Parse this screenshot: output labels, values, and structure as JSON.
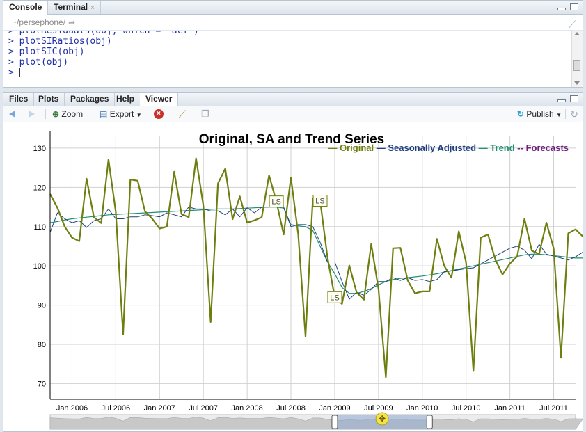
{
  "console_pane": {
    "tabs": [
      {
        "label": "Console"
      },
      {
        "label": "Terminal",
        "close": "×"
      }
    ],
    "path": "~/persephone/",
    "lines": [
      {
        "prompt": ">",
        "code": "plotResiduals(obj, which = \"acf\")"
      },
      {
        "prompt": ">",
        "code": "plotSIRatios(obj)"
      },
      {
        "prompt": ">",
        "code": "plotSIC(obj)"
      },
      {
        "prompt": ">",
        "code": "plot(obj)"
      },
      {
        "prompt": ">",
        "code": ""
      }
    ]
  },
  "viewer_pane": {
    "tabs": [
      {
        "label": "Files"
      },
      {
        "label": "Plots"
      },
      {
        "label": "Packages"
      },
      {
        "label": "Help"
      },
      {
        "label": "Viewer"
      }
    ],
    "active_tab": "Viewer",
    "toolbar": {
      "zoom": "Zoom",
      "export": "Export",
      "publish": "Publish"
    }
  },
  "icons": [
    "back-arrow-icon",
    "forward-arrow-icon",
    "zoom-icon",
    "export-icon",
    "clear-viewer-icon",
    "broom-icon",
    "popout-icon",
    "publish-icon",
    "refresh-icon",
    "minimize-icon",
    "maximize-icon",
    "pan-handle-icon"
  ],
  "colors": {
    "original": "#6f7f0f",
    "seasonally_adjusted": "#1f3f7f",
    "trend": "#1f8f6f",
    "forecasts": "#6f1f7f",
    "grid": "#d0d0d0"
  },
  "chart_data": {
    "type": "line",
    "title": "Original, SA and Trend Series",
    "ylim": [
      66,
      133
    ],
    "yticks": [
      70,
      80,
      90,
      100,
      110,
      120,
      130
    ],
    "x_start": "2005-10",
    "x_end": "2011-10",
    "xticks": [
      "Jan 2006",
      "Jul 2006",
      "Jan 2007",
      "Jul 2007",
      "Jan 2008",
      "Jul 2008",
      "Jan 2009",
      "Jul 2009",
      "Jan 2010",
      "Jul 2010",
      "Jan 2011",
      "Jul 2011"
    ],
    "grid": true,
    "legend_position": "top-right",
    "legend": [
      {
        "name": "Original",
        "color": "#6f7f0f"
      },
      {
        "name": "Seasonally Adjusted",
        "color": "#1f3f7f"
      },
      {
        "name": "Trend",
        "color": "#1f8f6f"
      },
      {
        "name": "Forecasts",
        "color": "#6f1f7f",
        "dashed": true
      }
    ],
    "annotations": [
      {
        "label": "LS",
        "date": "2008-05"
      },
      {
        "label": "LS",
        "date": "2008-11"
      },
      {
        "label": "LS",
        "date": "2009-01"
      }
    ],
    "series": [
      {
        "name": "Original",
        "start": "2005-10",
        "values": [
          118.3,
          114.8,
          110,
          107.2,
          106.3,
          122.2,
          112.4,
          110.9,
          127.1,
          113.7,
          82.5,
          122,
          121.7,
          113.9,
          112,
          109.5,
          110,
          124,
          113.2,
          112.4,
          127.4,
          115.4,
          85.7,
          121,
          124.8,
          111.9,
          117.7,
          111,
          111.6,
          112.4,
          123.1,
          116.4,
          108,
          122.5,
          108,
          82,
          117.2,
          116.6,
          102.2,
          92,
          90.3,
          100.1,
          93.2,
          91.4,
          105.6,
          94,
          71.6,
          104.5,
          104.6,
          96.3,
          93,
          93.5,
          93.5,
          106.9,
          100,
          97,
          108.8,
          100.9,
          73.2,
          107.2,
          108,
          101.6,
          97.8,
          100.6,
          102.4,
          112,
          103.9,
          103,
          111,
          104.5,
          76.6,
          108.3,
          109.3,
          107.5
        ]
      },
      {
        "name": "Seasonally Adjusted",
        "start": "2005-10",
        "values": [
          108.5,
          113.5,
          112,
          111,
          111.5,
          109.8,
          111.5,
          112,
          114.5,
          112,
          112,
          112.5,
          112.5,
          113,
          112.8,
          112.5,
          113.5,
          113,
          112.5,
          115,
          114.5,
          114.5,
          114,
          114,
          113,
          114.5,
          112.5,
          114.8,
          113.5,
          115,
          115,
          115.3,
          115,
          110,
          110.5,
          110.5,
          110,
          106,
          101,
          101,
          96,
          91.5,
          93.3,
          92.5,
          94,
          96,
          96,
          97,
          96.3,
          97,
          96.3,
          96.5,
          96,
          96.5,
          98.5,
          98.7,
          99,
          99.3,
          99.5,
          100.5,
          101.5,
          102.5,
          103.5,
          104.5,
          105,
          104,
          101.8,
          105.5,
          103,
          102.5,
          102,
          101.5,
          102.3,
          103.5
        ]
      },
      {
        "name": "Trend",
        "start": "2005-10",
        "values": [
          111,
          111.3,
          111.7,
          112,
          112.2,
          112.4,
          112.6,
          112.8,
          113,
          113.1,
          113.2,
          113.3,
          113.4,
          113.5,
          113.6,
          113.7,
          113.8,
          113.9,
          114,
          114.1,
          114.2,
          114.3,
          114.4,
          114.5,
          114.5,
          114.5,
          114.6,
          114.7,
          114.8,
          114.9,
          115,
          115,
          114.7,
          110.5,
          110.2,
          110,
          109,
          105,
          101,
          98,
          94.5,
          93,
          93,
          93.5,
          94.2,
          95.2,
          96,
          96.5,
          96.8,
          97,
          97.2,
          97.4,
          97.7,
          98,
          98.4,
          98.8,
          99.2,
          99.6,
          100,
          100.4,
          100.8,
          101.2,
          101.6,
          102,
          102.4,
          102.8,
          103,
          103,
          102.8,
          102.6,
          102.4,
          102.2,
          102,
          102
        ]
      }
    ],
    "range_selector": {
      "from": "2009-01",
      "to": "2010-02"
    }
  }
}
